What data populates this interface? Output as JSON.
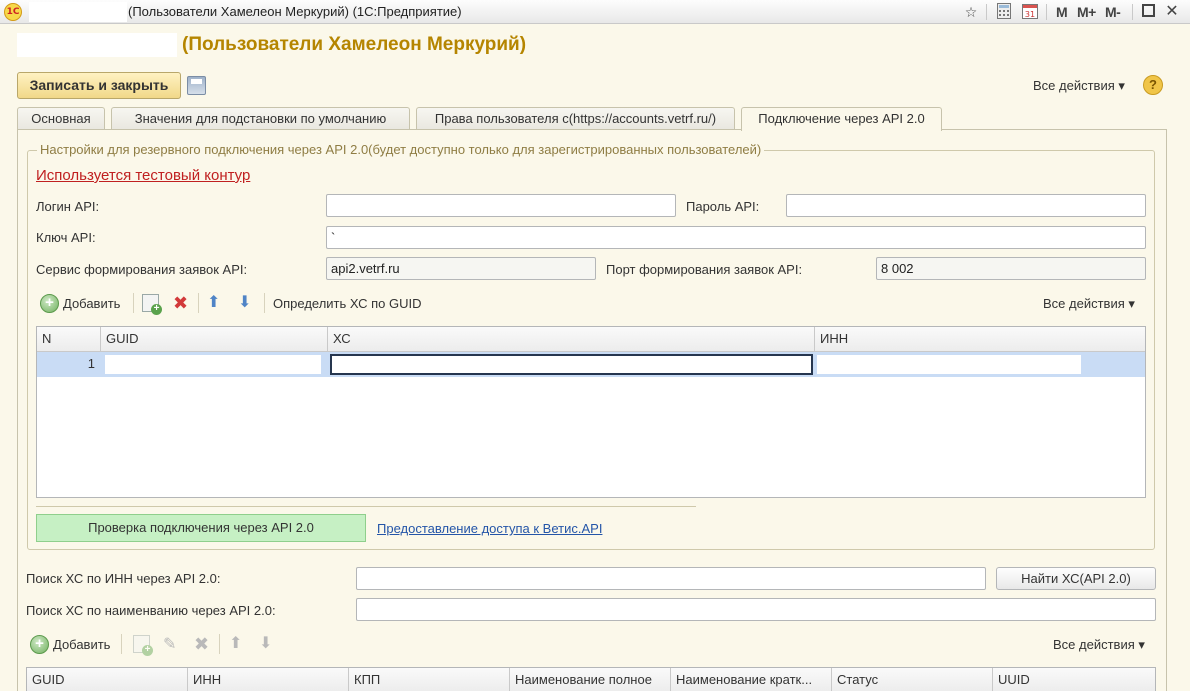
{
  "window": {
    "title": "(Пользователи Хамелеон Меркурий)  (1С:Предприятие)",
    "logo_text": "1C",
    "memory_buttons": [
      "M",
      "M+",
      "M-"
    ],
    "icons": [
      "favorite-icon",
      "calculator-icon",
      "calendar-icon",
      "minimize-icon",
      "maximize-icon",
      "close-icon"
    ]
  },
  "form": {
    "title": "(Пользователи Хамелеон Меркурий)",
    "save_close_label": "Записать и закрыть",
    "all_actions_label": "Все действия ▾",
    "help_label": "?"
  },
  "tabs": [
    {
      "label": "Основная"
    },
    {
      "label": "Значения для подстановки по умолчанию"
    },
    {
      "label": "Права пользователя с(https://accounts.vetrf.ru/)"
    },
    {
      "label": "Подключение через API 2.0",
      "active": true
    }
  ],
  "api_group": {
    "title": "Настройки для резервного подключения через API 2.0(будет доступно только для зарегистрированных пользователей)",
    "test_contour_link": "Используется тестовый контур",
    "login_label": "Логин API:",
    "login_value": "",
    "password_label": "Пароль API:",
    "password_value": "",
    "key_label": "Ключ API:",
    "key_value": "`",
    "service_label": "Сервис формирования заявок API:",
    "service_value": "api2.vetrf.ru",
    "port_label": "Порт формирования заявок API:",
    "port_value": "8 002",
    "toolbar": {
      "add_label": "Добавить",
      "define_label": "Определить ХС по GUID",
      "all_actions_label": "Все действия ▾"
    },
    "table": {
      "columns": [
        "N",
        "GUID",
        "ХС",
        "ИНН"
      ],
      "rows": [
        {
          "n": "1",
          "guid": "",
          "hs": "",
          "inn": ""
        }
      ]
    },
    "check_button": "Проверка подключения через API 2.0",
    "access_link": "Предоставление доступа к Ветис.API"
  },
  "search": {
    "by_inn_label": "Поиск ХС по ИНН через API 2.0:",
    "by_inn_value": "",
    "find_button": "Найти ХС(API 2.0)",
    "by_name_label": "Поиск ХС по наименванию через API 2.0:",
    "by_name_value": ""
  },
  "results": {
    "toolbar": {
      "add_label": "Добавить",
      "all_actions_label": "Все действия ▾"
    },
    "columns": [
      "GUID",
      "ИНН",
      "КПП",
      "Наименование полное",
      "Наименование кратк...",
      "Статус",
      "UUID"
    ]
  }
}
